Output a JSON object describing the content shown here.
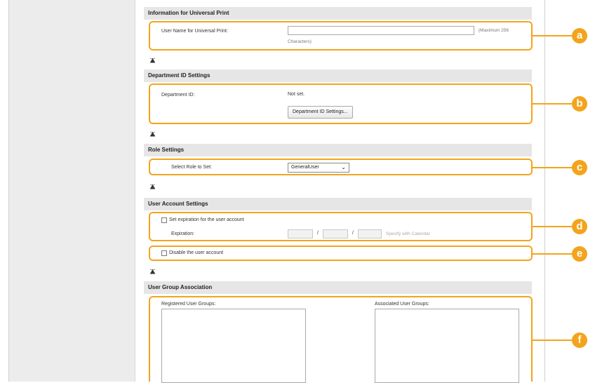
{
  "universal_print": {
    "section_title": "Information for Universal Print",
    "user_name_label": "User Name for Universal Print:",
    "user_name_value": "",
    "hint_line1": "(Maximum 256",
    "hint_line2": "Characters)"
  },
  "department": {
    "section_title": "Department ID Settings",
    "id_label": "Department ID:",
    "id_value": "Not set.",
    "settings_button": "Department ID Settings..."
  },
  "role": {
    "section_title": "Role Settings",
    "select_label": "Select Role to Set:",
    "selected_value": "GeneralUser"
  },
  "account": {
    "section_title": "User Account Settings",
    "expiration_checkbox_label": "Set expiration for the user account",
    "expiration_label": "Expiration:",
    "date_separator": "/",
    "calendar_link": "Specify with Calendar",
    "disable_checkbox_label": "Disable the user account"
  },
  "group": {
    "section_title": "User Group Association",
    "registered_label": "Registered User Groups:",
    "associated_label": "Associated User Groups:"
  },
  "callouts": {
    "a": "a",
    "b": "b",
    "c": "c",
    "d": "d",
    "e": "e",
    "f": "f",
    "color": "#f3a41c"
  }
}
